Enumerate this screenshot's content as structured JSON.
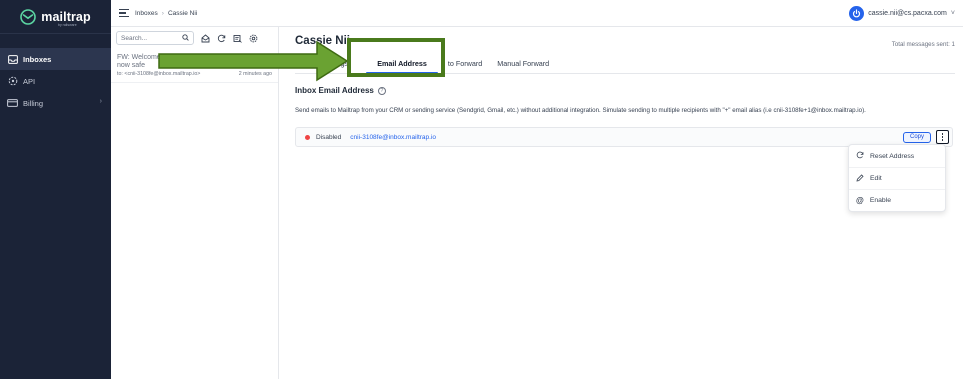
{
  "sidebar": {
    "brand": "mailtrap",
    "brand_sub": "by railsware",
    "items": [
      {
        "label": "Inboxes",
        "icon": "inbox-icon",
        "active": true
      },
      {
        "label": "API",
        "icon": "api-icon",
        "active": false
      },
      {
        "label": "Billing",
        "icon": "billing-icon",
        "active": false,
        "has_chevron": true
      }
    ]
  },
  "topbar": {
    "breadcrumb": [
      "Inboxes",
      "Cassie Nii"
    ],
    "breadcrumb_sep": "›",
    "account_email": "cassie.nii@cs.pacxa.com",
    "account_chevron": "˅"
  },
  "list": {
    "search_placeholder": "Search...",
    "messages": [
      {
        "subject_line1": "FW: Welcome",
        "subject_line2": "now safe",
        "to": "to: <cnii-3108fe@inbox.mailtrap.io>",
        "time": "2 minutes ago"
      }
    ]
  },
  "main": {
    "title": "Cassie Nii",
    "total_sent": "Total messages sent: 1",
    "tabs": [
      {
        "label": "Settings",
        "display": "ings",
        "active": false
      },
      {
        "label": "Email Address",
        "display": "Email Address",
        "active": true
      },
      {
        "label": "Auto Forward",
        "display": "to Forward",
        "active": false
      },
      {
        "label": "Manual Forward",
        "display": "Manual Forward",
        "active": false
      }
    ],
    "section_title": "Inbox Email Address",
    "section_help": "?",
    "description": "Send emails to Mailtrap from your CRM or sending service (Sendgrid, Gmail, etc.) without additional integration. Simulate sending to multiple recipients with \"+\" email alias (i.e cnii-3108fe+1@inbox.mailtrap.io).",
    "address": {
      "status": "Disabled",
      "status_color": "#ef4444",
      "email": "cnii-3108fe@inbox.mailtrap.io",
      "copy_label": "Copy"
    },
    "menu": [
      {
        "label": "Reset Address",
        "icon": "refresh-icon"
      },
      {
        "label": "Edit",
        "icon": "pencil-icon"
      },
      {
        "label": "Enable",
        "icon": "at-icon"
      }
    ]
  },
  "colors": {
    "sidebar_bg": "#1b2337",
    "accent": "#2563eb",
    "annotation": "#4a7a1c"
  }
}
